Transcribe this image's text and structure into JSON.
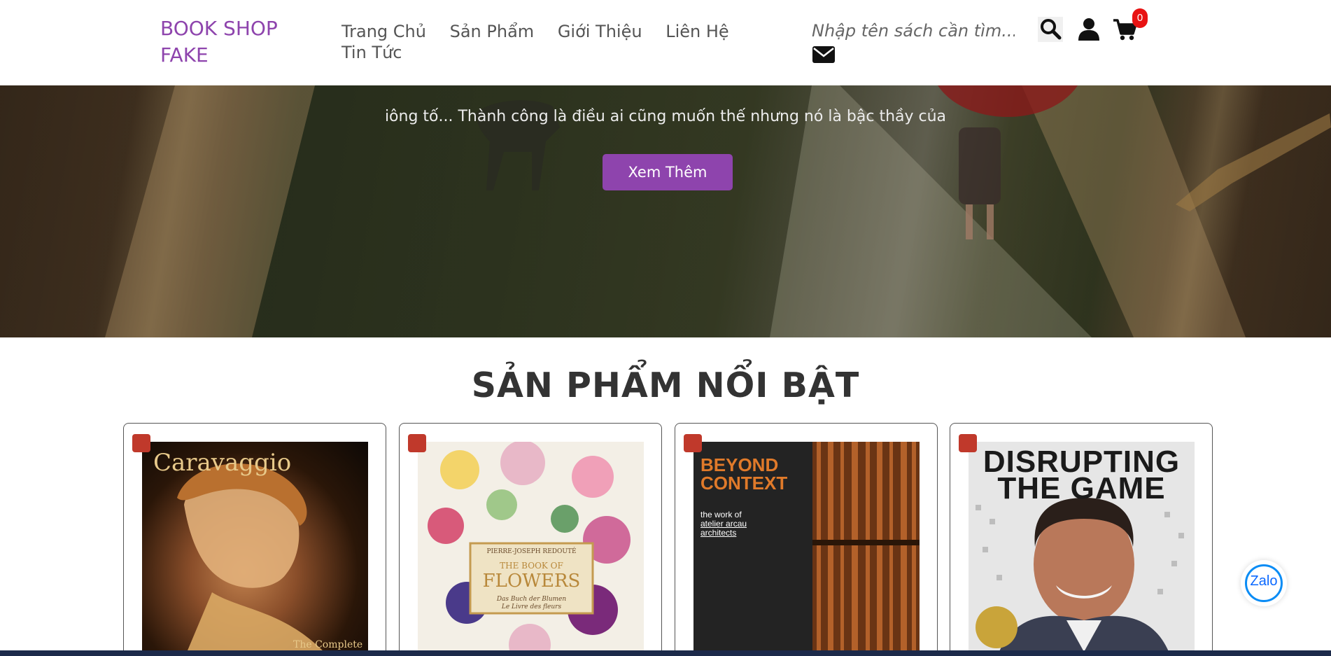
{
  "header": {
    "logo": "BOOK SHOP FAKE",
    "nav": [
      "Trang Chủ",
      "Sản Phẩm",
      "Giới Thiệu",
      "Liên Hệ",
      "Tin Tức"
    ],
    "search_placeholder": "Nhập tên sách cần tìm...",
    "cart_count": "0"
  },
  "hero": {
    "text": "iông tố... Thành công là điều ai cũng muốn thế nhưng nó là bậc thầy của",
    "button": "Xem Thêm"
  },
  "featured": {
    "title": "SẢN PHẨM NỔI BẬT",
    "products": [
      {
        "cover_title": "Caravaggio",
        "cover_subtitle": "The Complete"
      },
      {
        "cover_author": "PIERRE-JOSEPH REDOUTÉ",
        "cover_title_1": "THE BOOK OF",
        "cover_title_2": "FLOWERS",
        "cover_sub_1": "Das Buch der Blumen",
        "cover_sub_2": "Le Livre des fleurs"
      },
      {
        "cover_title_1": "BEYOND",
        "cover_title_2": "CONTEXT",
        "cover_sub_1": "the work of",
        "cover_sub_2": "atelier arcau",
        "cover_sub_3": "architects"
      },
      {
        "cover_title_1": "DISRUPTING",
        "cover_title_2": "THE GAME"
      }
    ]
  },
  "zalo": {
    "label": "Zalo"
  }
}
